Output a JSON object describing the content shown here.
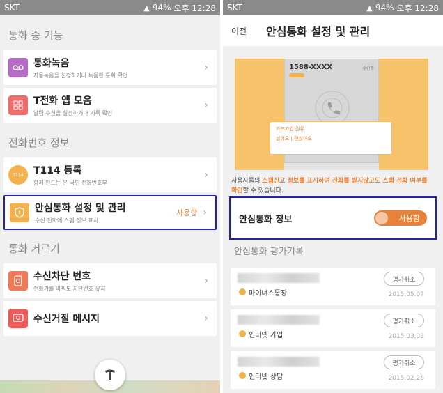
{
  "left": {
    "status": {
      "carrier": "SKT",
      "battery": "94%",
      "time": "오후 12:28"
    },
    "sections": [
      {
        "title": "통화 중 기능",
        "items": [
          {
            "label": "통화녹음",
            "sub": "자동녹음을 설정하거나 녹음한 통화 확인",
            "icon": "voicemail-icon",
            "color": "#b56ac6"
          },
          {
            "label": "T전화 앱 모음",
            "sub": "알림 수신을 설정하거나 기록 확인",
            "icon": "apps-grid-icon",
            "color": "#ef6c6c"
          }
        ]
      },
      {
        "title": "전화번호 정보",
        "items": [
          {
            "label": "T114 등록",
            "sub": "함께 만드는 온 국민 전화번호부",
            "icon": "t114-icon",
            "color": "#f3b24e"
          },
          {
            "label": "안심통화 설정 및 관리",
            "sub": "수신 전화에 스팸 정보 표시",
            "icon": "shield-icon",
            "color": "#f3b24e",
            "state": "사용함"
          }
        ]
      },
      {
        "title": "통화 거르기",
        "items": [
          {
            "label": "수신차단 번호",
            "sub": "전화가를 바꿔도 차단번호 유지",
            "icon": "block-phone-icon",
            "color": "#f07a56"
          },
          {
            "label": "수신거절 메시지",
            "sub": "",
            "icon": "message-icon",
            "color": "#ee5b5b"
          }
        ]
      }
    ]
  },
  "right": {
    "status": {
      "carrier": "SKT",
      "battery": "94%",
      "time": "오후 12:28"
    },
    "header": {
      "back": "이전",
      "title": "안심통화 설정 및 관리"
    },
    "banner": {
      "number": "1588-XXXX",
      "incoming": "수신중",
      "popup_title": "카드가입 권유",
      "popup_line": "싫어요 | 괜찮아요"
    },
    "description": {
      "p1": "사용자들의 ",
      "h1": "스팸신고 정보를 표시하여 전화를 받지않고도 스팸 전화 여부를 확인",
      "p2": "할 수 있습니다."
    },
    "info": {
      "label": "안심통화 정보",
      "toggle": "사용함"
    },
    "eval_title": "안심통화 평가기록",
    "records": [
      {
        "label": "마이너스통장",
        "button": "평가취소",
        "date": "2015.05.07"
      },
      {
        "label": "인터넷 가입",
        "button": "평가취소",
        "date": "2015.03.03"
      },
      {
        "label": "인터넷 상담",
        "button": "평가취소",
        "date": "2015.02.26"
      }
    ]
  }
}
